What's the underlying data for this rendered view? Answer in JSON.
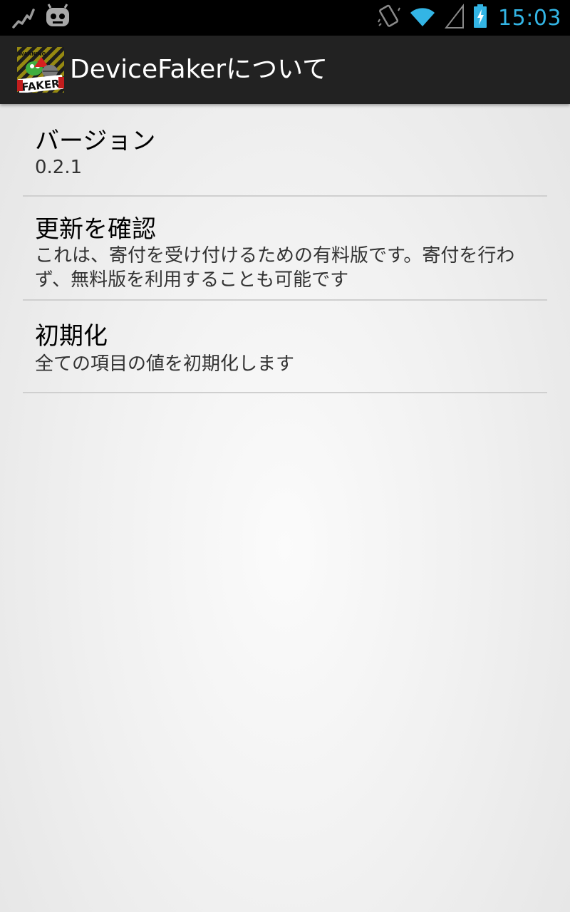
{
  "status_bar": {
    "time": "15:03",
    "time_color": "#33b5e5",
    "left_icons": [
      "activity-graph-icon",
      "cyanogenmod-icon"
    ],
    "right_icons": [
      "vibrate-icon",
      "wifi-icon",
      "signal-icon",
      "battery-charging-icon"
    ]
  },
  "action_bar": {
    "title": "DeviceFakerについて",
    "icon_name": "device-faker-app-icon",
    "icon_text_warning": "WARNING",
    "icon_text_faker": "FAKER"
  },
  "preferences": [
    {
      "title": "バージョン",
      "summary": "0.2.1"
    },
    {
      "title": "更新を確認",
      "summary": "これは、寄付を受け付けるための有料版です。寄付を行わず、無料版を利用することも可能です"
    },
    {
      "title": "初期化",
      "summary": "全ての項目の値を初期化します"
    }
  ]
}
